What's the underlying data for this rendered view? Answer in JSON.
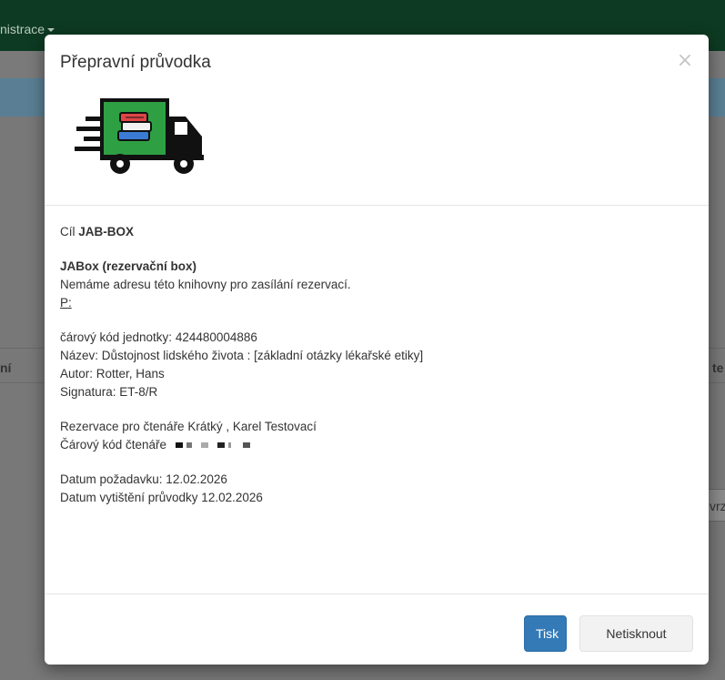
{
  "background": {
    "nav_admin_label": "nistrace",
    "column_left_fragment": "ní",
    "column_right_fragment": "te",
    "right_button_fragment": "vrz"
  },
  "modal": {
    "title": "Přepravní průvodka",
    "close_label": "×",
    "image": "truck-books-icon",
    "target_prefix": "Cíl",
    "target_value": "JAB-BOX",
    "library_name": "JABox (rezervační box)",
    "no_address_text": "Nemáme adresu této knihovny pro zasílání rezervací.",
    "p_label": "P:",
    "barcode_line": "čárový kód jednotky: 424480004886",
    "title_line": "Název: Důstojnost lidského života : [základní otázky lékařské etiky]",
    "author_line": "Autor: Rotter, Hans",
    "signature_line": "Signatura:  ET-8/R",
    "reservation_line": "Rezervace pro čtenáře Krátký , Karel Testovací",
    "reader_barcode_label": "Čárový kód čtenáře",
    "request_date_line": "Datum požadavku: 12.02.2026",
    "print_date_line": "Datum vytištění průvodky 12.02.2026",
    "print_button": "Tisk",
    "no_print_button": "Netisknout"
  },
  "colors": {
    "truck_cargo": "#2ea043",
    "primary_button": "#337ab7",
    "navbar": "#0d3a22"
  }
}
